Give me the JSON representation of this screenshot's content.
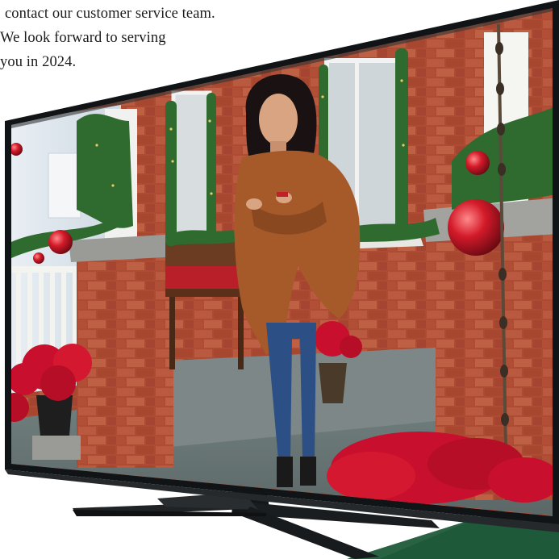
{
  "ad_copy": {
    "lines": [
      "contact our customer service team.",
      "We look forward to serving",
      "you in 2024."
    ]
  },
  "colors": {
    "tv_bezel": "#111416",
    "stand": "#1c1f21",
    "green_shape": "#1f5a3a",
    "brick": "#b5523a",
    "coat": "#a65a2a",
    "jeans": "#2c4f86",
    "poinsettia": "#c8102e",
    "garland": "#2f6b2f"
  }
}
